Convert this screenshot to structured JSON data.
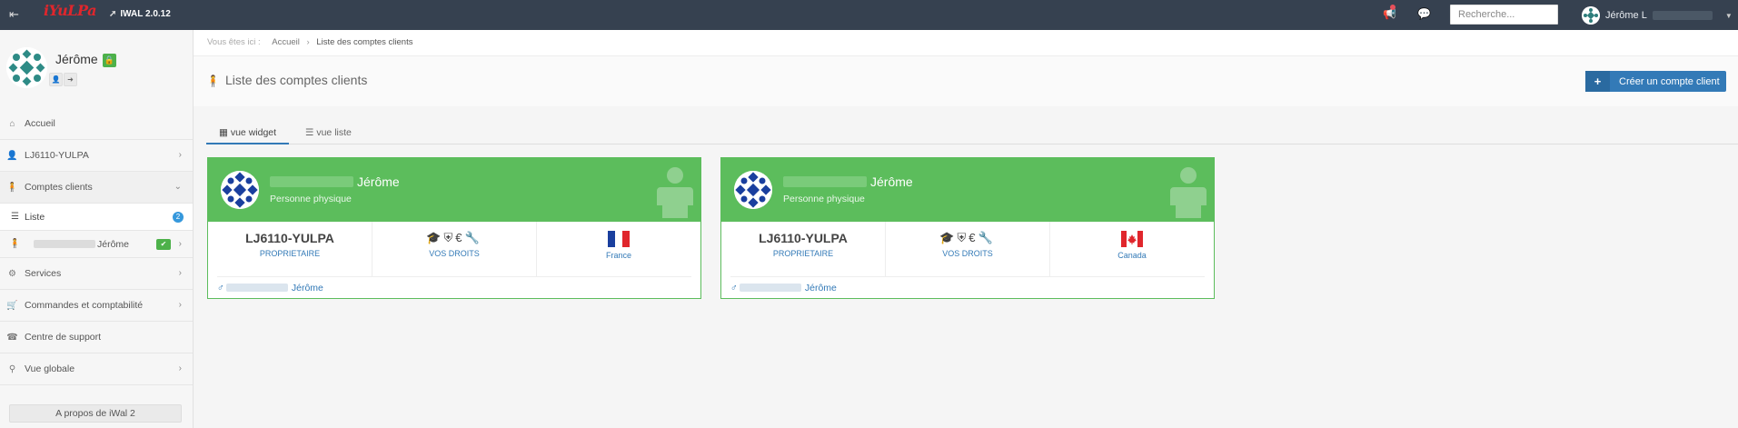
{
  "topbar": {
    "menu_icon": "hamburger-arrow-icon",
    "logo_text": "iYuLPa",
    "version": "IWAL 2.0.12",
    "search_placeholder": "Recherche...",
    "user_name": "Jérôme L"
  },
  "sidebar": {
    "profile": {
      "name": "Jérôme"
    },
    "items": [
      {
        "label": "Accueil",
        "icon": "home-icon"
      },
      {
        "label": "LJ6110-YULPA",
        "icon": "user-icon"
      },
      {
        "label": "Comptes clients",
        "icon": "person-icon"
      },
      {
        "label": "Services",
        "icon": "cogs-icon"
      },
      {
        "label": "Commandes et comptabilité",
        "icon": "cart-icon"
      },
      {
        "label": "Centre de support",
        "icon": "support-icon"
      },
      {
        "label": "Vue globale",
        "icon": "binoculars-icon"
      }
    ],
    "sub_list": {
      "label": "Liste",
      "count": "2"
    },
    "sub_client": {
      "label": "Jérôme"
    },
    "about": "A propos de iWal 2"
  },
  "breadcrumb": {
    "prefix": "Vous êtes ici :",
    "home": "Accueil",
    "current": "Liste des comptes clients"
  },
  "page": {
    "title": "Liste des comptes clients",
    "create_button": "Créer un compte client"
  },
  "tabs": [
    {
      "label": "vue widget",
      "active": true
    },
    {
      "label": "vue liste",
      "active": false
    }
  ],
  "cards": [
    {
      "name": "Jérôme",
      "type": "Personne physique",
      "account": "LJ6110-YULPA",
      "account_role": "PROPRIETAIRE",
      "rights_label": "VOS DROITS",
      "country": "France",
      "owner": "Jérôme"
    },
    {
      "name": "Jérôme",
      "type": "Personne physique",
      "account": "LJ6110-YULPA",
      "account_role": "PROPRIETAIRE",
      "rights_label": "VOS DROITS",
      "country": "Canada",
      "owner": "Jérôme"
    }
  ],
  "colors": {
    "topbar": "#364150",
    "card_green": "#5cbd5c",
    "primary_blue": "#337ab7"
  }
}
